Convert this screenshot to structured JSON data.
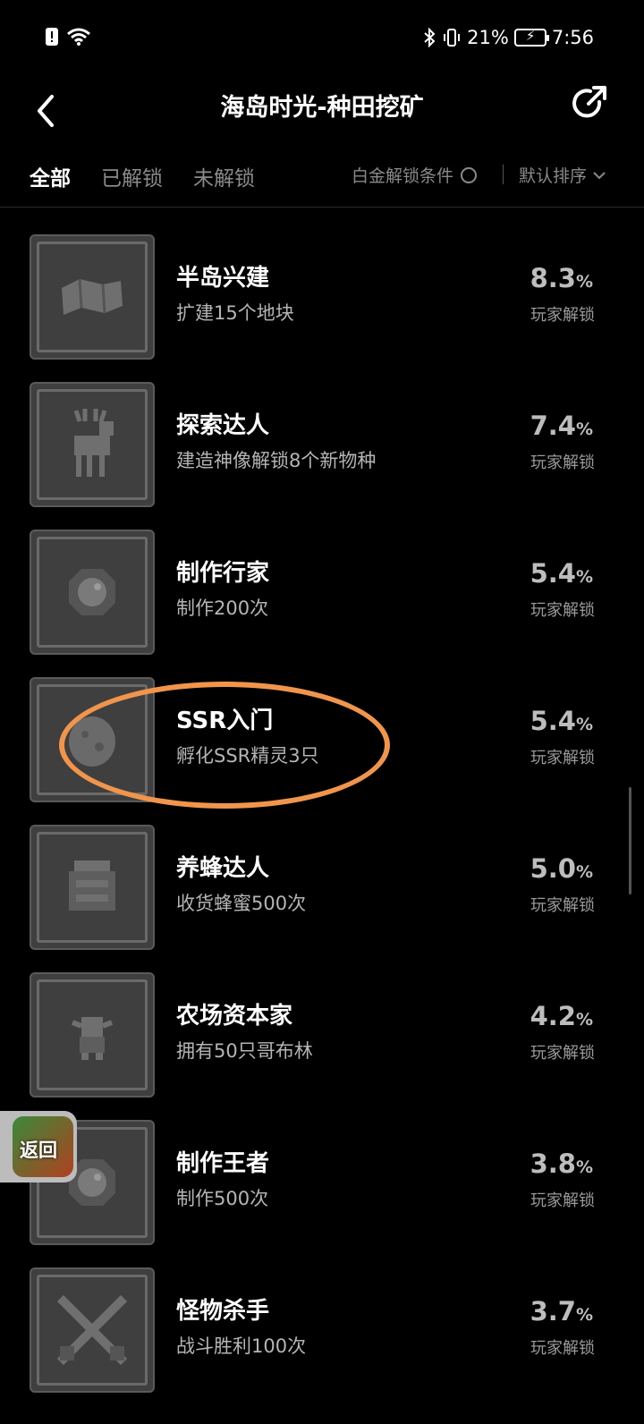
{
  "status_bar": {
    "battery": "21%",
    "time": "7:56"
  },
  "header": {
    "title": "海岛时光-种田挖矿"
  },
  "tabs": {
    "all": "全部",
    "unlocked": "已解锁",
    "locked": "未解锁"
  },
  "filters": {
    "platinum": "白金解锁条件",
    "sort": "默认排序"
  },
  "achievements": [
    {
      "title": "半岛兴建",
      "desc": "扩建15个地块",
      "percent": "8.3",
      "unit": "%",
      "sub": "玩家解锁",
      "icon": "map-scroll-icon"
    },
    {
      "title": "探索达人",
      "desc": "建造神像解锁8个新物种",
      "percent": "7.4",
      "unit": "%",
      "sub": "玩家解锁",
      "icon": "deer-icon"
    },
    {
      "title": "制作行家",
      "desc": "制作200次",
      "percent": "5.4",
      "unit": "%",
      "sub": "玩家解锁",
      "icon": "gem-icon"
    },
    {
      "title": "SSR入门",
      "desc": "孵化SSR精灵3只",
      "percent": "5.4",
      "unit": "%",
      "sub": "玩家解锁",
      "icon": "egg-icon"
    },
    {
      "title": "养蜂达人",
      "desc": "收货蜂蜜500次",
      "percent": "5.0",
      "unit": "%",
      "sub": "玩家解锁",
      "icon": "beehive-icon"
    },
    {
      "title": "农场资本家",
      "desc": "拥有50只哥布林",
      "percent": "4.2",
      "unit": "%",
      "sub": "玩家解锁",
      "icon": "goblin-icon"
    },
    {
      "title": "制作王者",
      "desc": "制作500次",
      "percent": "3.8",
      "unit": "%",
      "sub": "玩家解锁",
      "icon": "gem-icon"
    },
    {
      "title": "怪物杀手",
      "desc": "战斗胜利100次",
      "percent": "3.7",
      "unit": "%",
      "sub": "玩家解锁",
      "icon": "crossed-swords-icon"
    }
  ],
  "float_button": {
    "label": "返回"
  },
  "colors": {
    "annotation": "#f0954b",
    "background": "#000000"
  }
}
